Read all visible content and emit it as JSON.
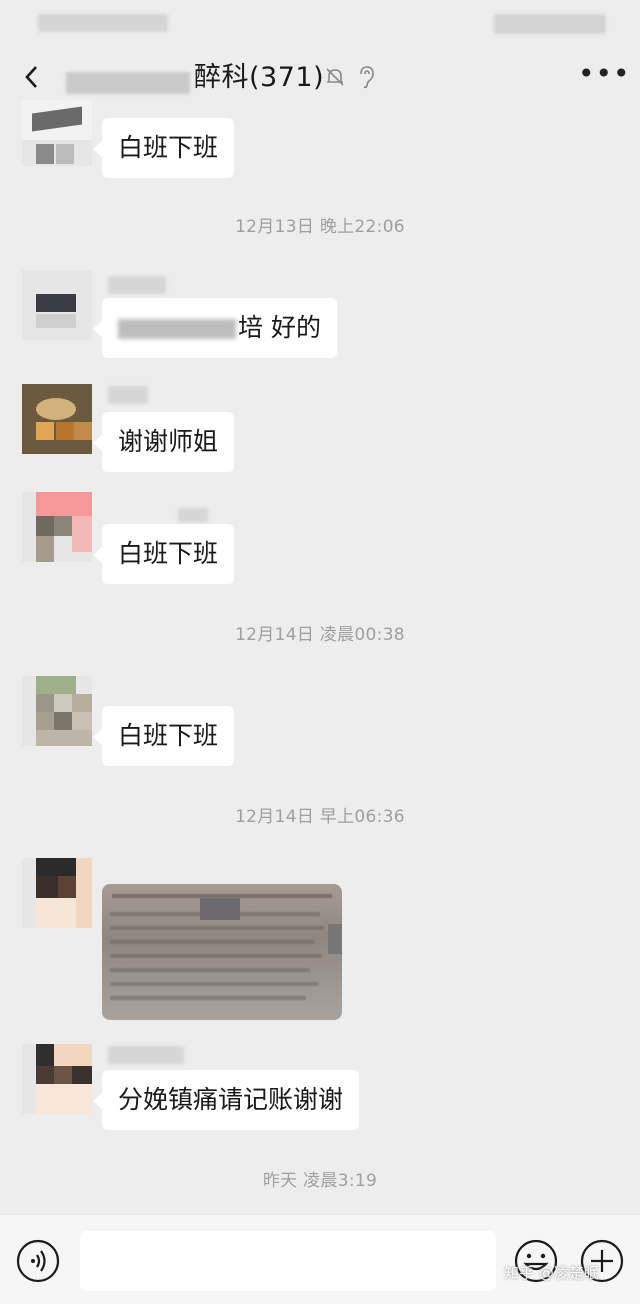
{
  "header": {
    "title": "醉科(371)",
    "icons": [
      "back-icon",
      "mute-icon",
      "ear-icon",
      "more-icon"
    ]
  },
  "messages": [
    {
      "kind": "text",
      "text": "白班下班"
    },
    {
      "kind": "time",
      "text": "12月13日 晚上22:06"
    },
    {
      "kind": "text",
      "text": "培  好的"
    },
    {
      "kind": "text",
      "text": "谢谢师姐"
    },
    {
      "kind": "text",
      "text": "白班下班"
    },
    {
      "kind": "time",
      "text": "12月14日 凌晨00:38"
    },
    {
      "kind": "text",
      "text": "白班下班"
    },
    {
      "kind": "time",
      "text": "12月14日 早上06:36"
    },
    {
      "kind": "image",
      "text": ""
    },
    {
      "kind": "text",
      "text": "分娩镇痛请记账谢谢"
    },
    {
      "kind": "time",
      "text": "昨天 凌晨3:19"
    }
  ],
  "input_bar": {
    "icons": [
      "voice-icon",
      "emoji-icon",
      "plus-icon"
    ]
  },
  "watermark": "知乎 @凌楚眠",
  "colors": {
    "background": "#ededed",
    "bubble": "#ffffff",
    "timestamp": "#9f9f9f",
    "input_bar": "#f6f6f6"
  }
}
